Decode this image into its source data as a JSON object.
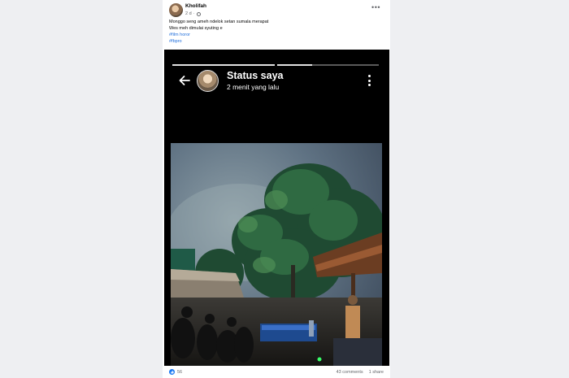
{
  "post": {
    "author": "Kholifah",
    "time": "2 d",
    "caption_lines": [
      "Monggo seng ameh ndelok setan sumala merapat",
      "Wes meh dimulai syuting e"
    ],
    "hashtags": [
      "#film horor",
      "#fbpro"
    ]
  },
  "story": {
    "title": "Status saya",
    "time": "2 menit yang lalu"
  },
  "footer": {
    "likes": "56",
    "comments": "43 comments",
    "shares": "1 share"
  },
  "colors": {
    "link": "#216fdb",
    "like_blue": "#1877f2",
    "page_bg": "#eeeff2"
  },
  "icons": [
    "globe-icon",
    "more-dots-icon",
    "back-arrow-icon",
    "vertical-dots-icon",
    "like-icon"
  ]
}
